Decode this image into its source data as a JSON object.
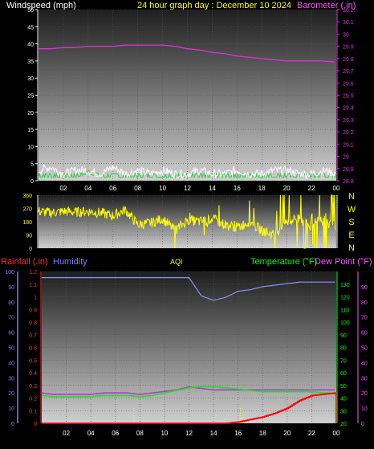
{
  "colors": {
    "background": "#000000",
    "panel_top": "#1e1e1e",
    "panel_bottom": "#cfcfcf",
    "wind_speed": "#ffffff",
    "wind_avg": "#2ecc40",
    "barometer": "#e030e0",
    "wind_dir": "#ffff00",
    "humidity": "#8f8fff",
    "temperature": "#22dd22",
    "dew_point": "#b03ad0",
    "rainfall": "#ff0000",
    "title": "#ffff00",
    "label_white": "#ffffff",
    "label_blue": "#7f7fff",
    "label_green": "#00ff00",
    "label_pink": "#ff55ff",
    "label_red": "#ff3030"
  },
  "header": {
    "windspeed_label": "Windspeed (mph)",
    "title": "24 hour graph day : December 10 2024",
    "barometer_label": "Barometer (.in)"
  },
  "bottom_labels": {
    "rainfall": "Rainfall (.in)",
    "humidity": "Humidity",
    "aqi": "AQI",
    "temperature": "Temperature (°F)",
    "dewpoint": "Dew Point (°F)"
  },
  "compass": [
    "N",
    "W",
    "S",
    "E",
    "N"
  ],
  "x_ticks": [
    "02",
    "04",
    "06",
    "08",
    "10",
    "12",
    "14",
    "16",
    "18",
    "20",
    "22",
    "00"
  ],
  "chart_data": [
    {
      "type": "line",
      "panel": "wind_barometer",
      "ylabel": "Windspeed (mph)",
      "ylim": [
        0,
        50
      ],
      "yticks": [
        0,
        5,
        10,
        15,
        20,
        25,
        30,
        35,
        40,
        45,
        50
      ],
      "y2label": "Barometer (.in)",
      "y2lim": [
        28.8,
        30.2
      ],
      "y2ticks": [
        "28.8",
        "28.9",
        "29",
        "29.1",
        "29.2",
        "29.3",
        "29.4",
        "29.5",
        "29.6",
        "29.7",
        "29.8",
        "29.9",
        "30",
        "30.1",
        "30.2"
      ],
      "x_hours": [
        0,
        1,
        2,
        3,
        4,
        5,
        6,
        7,
        8,
        9,
        10,
        11,
        12,
        13,
        14,
        15,
        16,
        17,
        18,
        19,
        20,
        21,
        22,
        23,
        24
      ],
      "series": [
        {
          "name": "Barometer",
          "axis": "y2",
          "color_key": "barometer",
          "values": [
            29.88,
            29.88,
            29.89,
            29.89,
            29.9,
            29.9,
            29.9,
            29.91,
            29.91,
            29.91,
            29.91,
            29.9,
            29.88,
            29.87,
            29.85,
            29.84,
            29.82,
            29.81,
            29.8,
            29.79,
            29.78,
            29.78,
            29.78,
            29.78,
            29.77
          ]
        },
        {
          "name": "Wind Speed",
          "axis": "y",
          "color_key": "wind_speed",
          "values": [
            3,
            4,
            2,
            3,
            3,
            2,
            4,
            2,
            3,
            2,
            3,
            2,
            2,
            3,
            2,
            2,
            3,
            2,
            2,
            3,
            3,
            2,
            2,
            3,
            2
          ]
        },
        {
          "name": "Wind Average",
          "axis": "y",
          "color_key": "wind_avg",
          "values": [
            1,
            1,
            1,
            1,
            2,
            1,
            1,
            1,
            1,
            1,
            1,
            1,
            1,
            1,
            1,
            1,
            1,
            1,
            1,
            1,
            1,
            1,
            1,
            1,
            1
          ]
        }
      ]
    },
    {
      "type": "scatter",
      "panel": "wind_direction",
      "ylabel": "Wind Direction",
      "ylim": [
        0,
        360
      ],
      "yticks": [
        0,
        90,
        180,
        270,
        360
      ],
      "x_hours": [
        0,
        1,
        2,
        3,
        4,
        5,
        6,
        7,
        8,
        9,
        10,
        11,
        12,
        13,
        14,
        15,
        16,
        17,
        18,
        19,
        20,
        21,
        22,
        23,
        24
      ],
      "series": [
        {
          "name": "Wind Direction",
          "color_key": "wind_dir",
          "values": [
            250,
            240,
            250,
            245,
            250,
            240,
            220,
            260,
            160,
            170,
            200,
            120,
            190,
            180,
            200,
            160,
            140,
            180,
            120,
            90,
            180,
            200,
            150,
            220,
            130
          ]
        }
      ]
    },
    {
      "type": "line",
      "panel": "temp_humidity_rain",
      "y_left_rain_lim": [
        0,
        1.2
      ],
      "y_left_rain_ticks": [
        "0",
        "0.1",
        "0.2",
        "0.3",
        "0.4",
        "0.5",
        "0.6",
        "0.7",
        "0.8",
        "0.9",
        "1",
        "1.1",
        "1.2"
      ],
      "y_left_hum_lim": [
        0,
        100
      ],
      "y_left_hum_ticks": [
        0,
        10,
        20,
        30,
        40,
        50,
        60,
        70,
        80,
        90,
        100
      ],
      "y_right_temp_lim": [
        20,
        140
      ],
      "y_right_temp_ticks": [
        20,
        30,
        40,
        50,
        60,
        70,
        80,
        90,
        100,
        110,
        120,
        130
      ],
      "y_right_dew_lim": [
        0,
        100
      ],
      "y_right_dew_ticks": [
        0,
        10,
        20,
        30,
        40,
        50,
        60,
        70,
        80,
        90
      ],
      "x_hours": [
        0,
        1,
        2,
        3,
        4,
        5,
        6,
        7,
        8,
        9,
        10,
        11,
        12,
        13,
        14,
        15,
        16,
        17,
        18,
        19,
        20,
        21,
        22,
        23,
        24
      ],
      "series": [
        {
          "name": "Humidity",
          "color_key": "humidity",
          "axis": "humidity",
          "values": [
            96,
            96,
            96,
            96,
            96,
            96,
            96,
            96,
            96,
            96,
            96,
            96,
            96,
            84,
            81,
            83,
            87,
            88,
            90,
            91,
            92,
            93,
            93,
            93,
            93
          ]
        },
        {
          "name": "Temperature",
          "color_key": "temperature",
          "axis": "temp",
          "values": [
            42,
            41,
            41,
            41,
            41,
            42,
            42,
            42,
            41,
            42,
            44,
            46,
            48,
            49,
            49,
            48,
            47,
            46,
            45,
            45,
            45,
            45,
            45,
            44,
            44
          ]
        },
        {
          "name": "Dew Point",
          "color_key": "dew_point",
          "axis": "dew",
          "values": [
            20,
            19,
            19,
            19,
            19,
            20,
            20,
            20,
            19,
            20,
            21,
            22,
            24,
            23,
            22,
            22,
            22,
            22,
            22,
            22,
            22,
            22,
            22,
            22,
            22
          ]
        },
        {
          "name": "Rainfall",
          "color_key": "rainfall",
          "axis": "rain",
          "values": [
            0,
            0,
            0,
            0,
            0,
            0,
            0,
            0,
            0,
            0,
            0,
            0,
            0,
            0,
            0,
            0,
            0.01,
            0.03,
            0.05,
            0.08,
            0.12,
            0.18,
            0.22,
            0.23,
            0.24
          ]
        }
      ]
    }
  ]
}
